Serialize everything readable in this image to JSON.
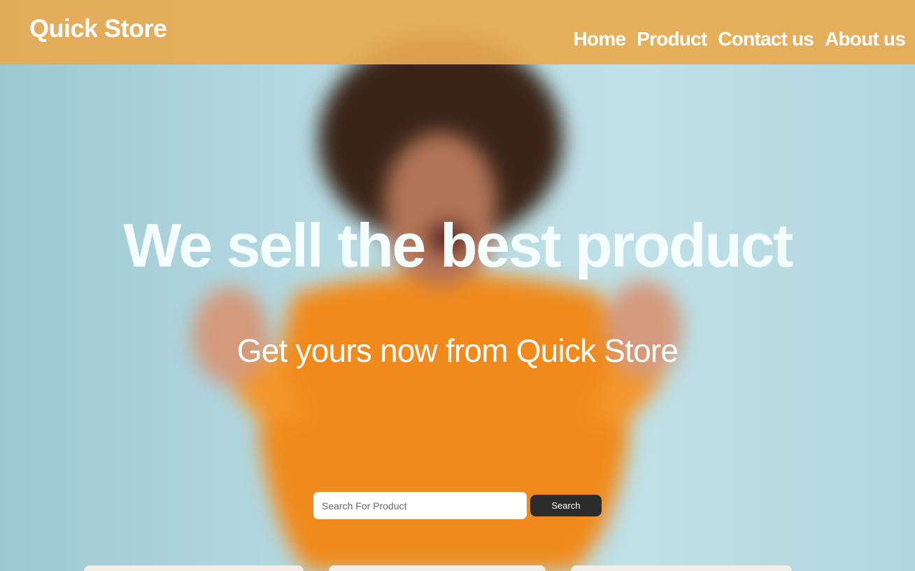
{
  "header": {
    "brand": "Quick Store",
    "nav": [
      {
        "label": "Home"
      },
      {
        "label": "Product"
      },
      {
        "label": "Contact us"
      },
      {
        "label": "About us"
      }
    ]
  },
  "hero": {
    "title": "We sell the best product",
    "subtitle": "Get yours now from Quick Store"
  },
  "search": {
    "placeholder": "Search For Product",
    "value": "",
    "button_label": "Search"
  },
  "colors": {
    "navbar_bg": "#e8aa50",
    "hero_text": "#f4fdff",
    "button_bg": "#2c2c2c",
    "sweater": "#f08a1c",
    "backdrop": "#b6dae2"
  }
}
